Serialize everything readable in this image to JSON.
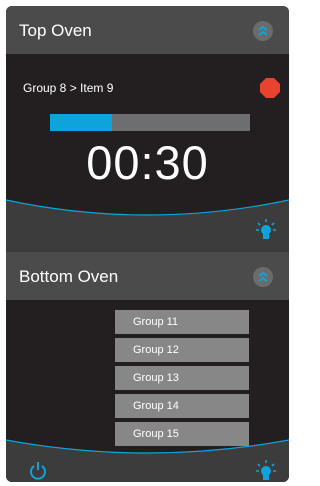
{
  "colors": {
    "panel": "#231f20",
    "header": "#4b4b4b",
    "footer": "#3c3c3c",
    "accent": "#0fa3dc",
    "stop": "#e8432f",
    "list_item": "#878787"
  },
  "top_oven": {
    "title": "Top Oven",
    "collapse_icon": "chevron-double-up-icon",
    "path": "Group 8 > Item 9",
    "stop_icon": "stop-octagon-icon",
    "progress": 0.31,
    "timer": "00:30",
    "light_icon": "light-bulb-icon"
  },
  "bottom_oven": {
    "title": "Bottom Oven",
    "collapse_icon": "chevron-double-up-icon",
    "groups": [
      "Group 11",
      "Group 12",
      "Group 13",
      "Group 14",
      "Group 15"
    ],
    "power_icon": "power-icon",
    "light_icon": "light-bulb-icon"
  }
}
